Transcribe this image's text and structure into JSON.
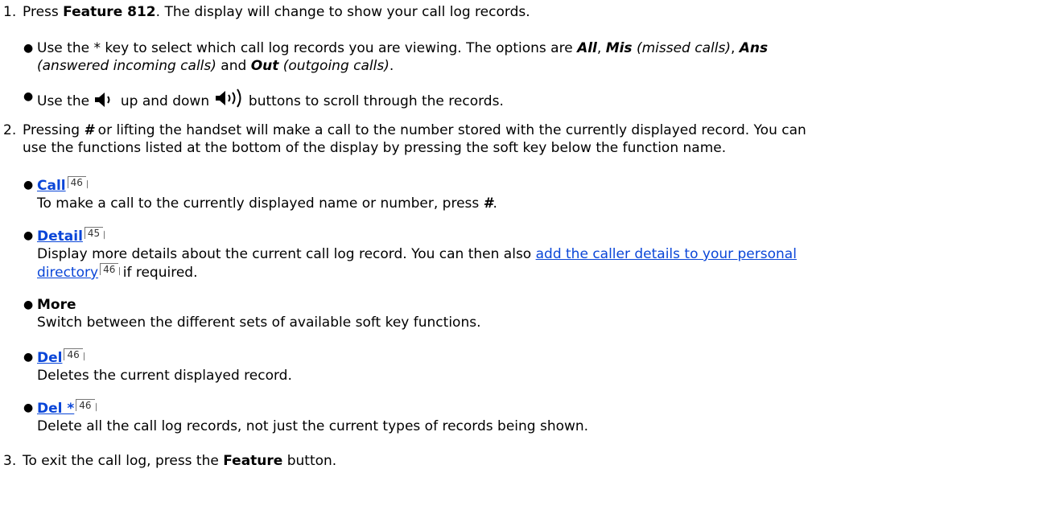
{
  "step1": {
    "number": "1.",
    "pre": "Press ",
    "feature": "Feature 812",
    "post": ". The display will change to show your call log records.",
    "bullet_a": {
      "pre": "Use the * key to select which call log records you are viewing. The options are ",
      "all": "All",
      "sep1": ", ",
      "mis": "Mis",
      "mis_desc": " (missed calls)",
      "sep2": ", ",
      "ans": "Ans",
      "ans_desc": " (answered incoming calls)",
      "and": " and ",
      "out": "Out",
      "out_desc": " (outgoing calls)",
      "end": "."
    },
    "bullet_b": {
      "pre": "Use the ",
      "mid": " up and down ",
      "post": " buttons to scroll through the records."
    }
  },
  "step2": {
    "number": "2.",
    "pre": "Pressing ",
    "hash": "#",
    "line1_post": " or lifting the handset will make a call to the number stored with the currently displayed record.  You can",
    "line2": "use the functions listed at the bottom of the display by pressing the soft key below the function name.",
    "items": [
      {
        "label": "Call",
        "page": "46",
        "desc_pre": "To make a call to the currently displayed name or number, press ",
        "desc_bold": "#",
        "desc_post": "."
      },
      {
        "label": "Detail",
        "page": "45",
        "desc_line1_pre": "Display more details about the current call log record. You can then also ",
        "desc_link_1": "add the caller details to your personal",
        "desc_link_2": "directory",
        "desc_link_page": "46",
        "desc_line2_post": " if required."
      },
      {
        "label": "More",
        "desc": "Switch between the different sets of available soft key functions."
      },
      {
        "label": "Del",
        "page": "46",
        "desc": "Deletes the current displayed record."
      },
      {
        "label": "Del *",
        "page": "46",
        "desc": "Delete all the call log records, not just the current types of records being shown."
      }
    ]
  },
  "step3": {
    "number": "3.",
    "pre": "To exit the call log, press the ",
    "feature": "Feature",
    "post": " button."
  },
  "icons": {
    "volume_down": "speaker-low-icon",
    "volume_up": "speaker-high-icon"
  },
  "colors": {
    "link": "#0a46d8",
    "text": "#000000"
  }
}
